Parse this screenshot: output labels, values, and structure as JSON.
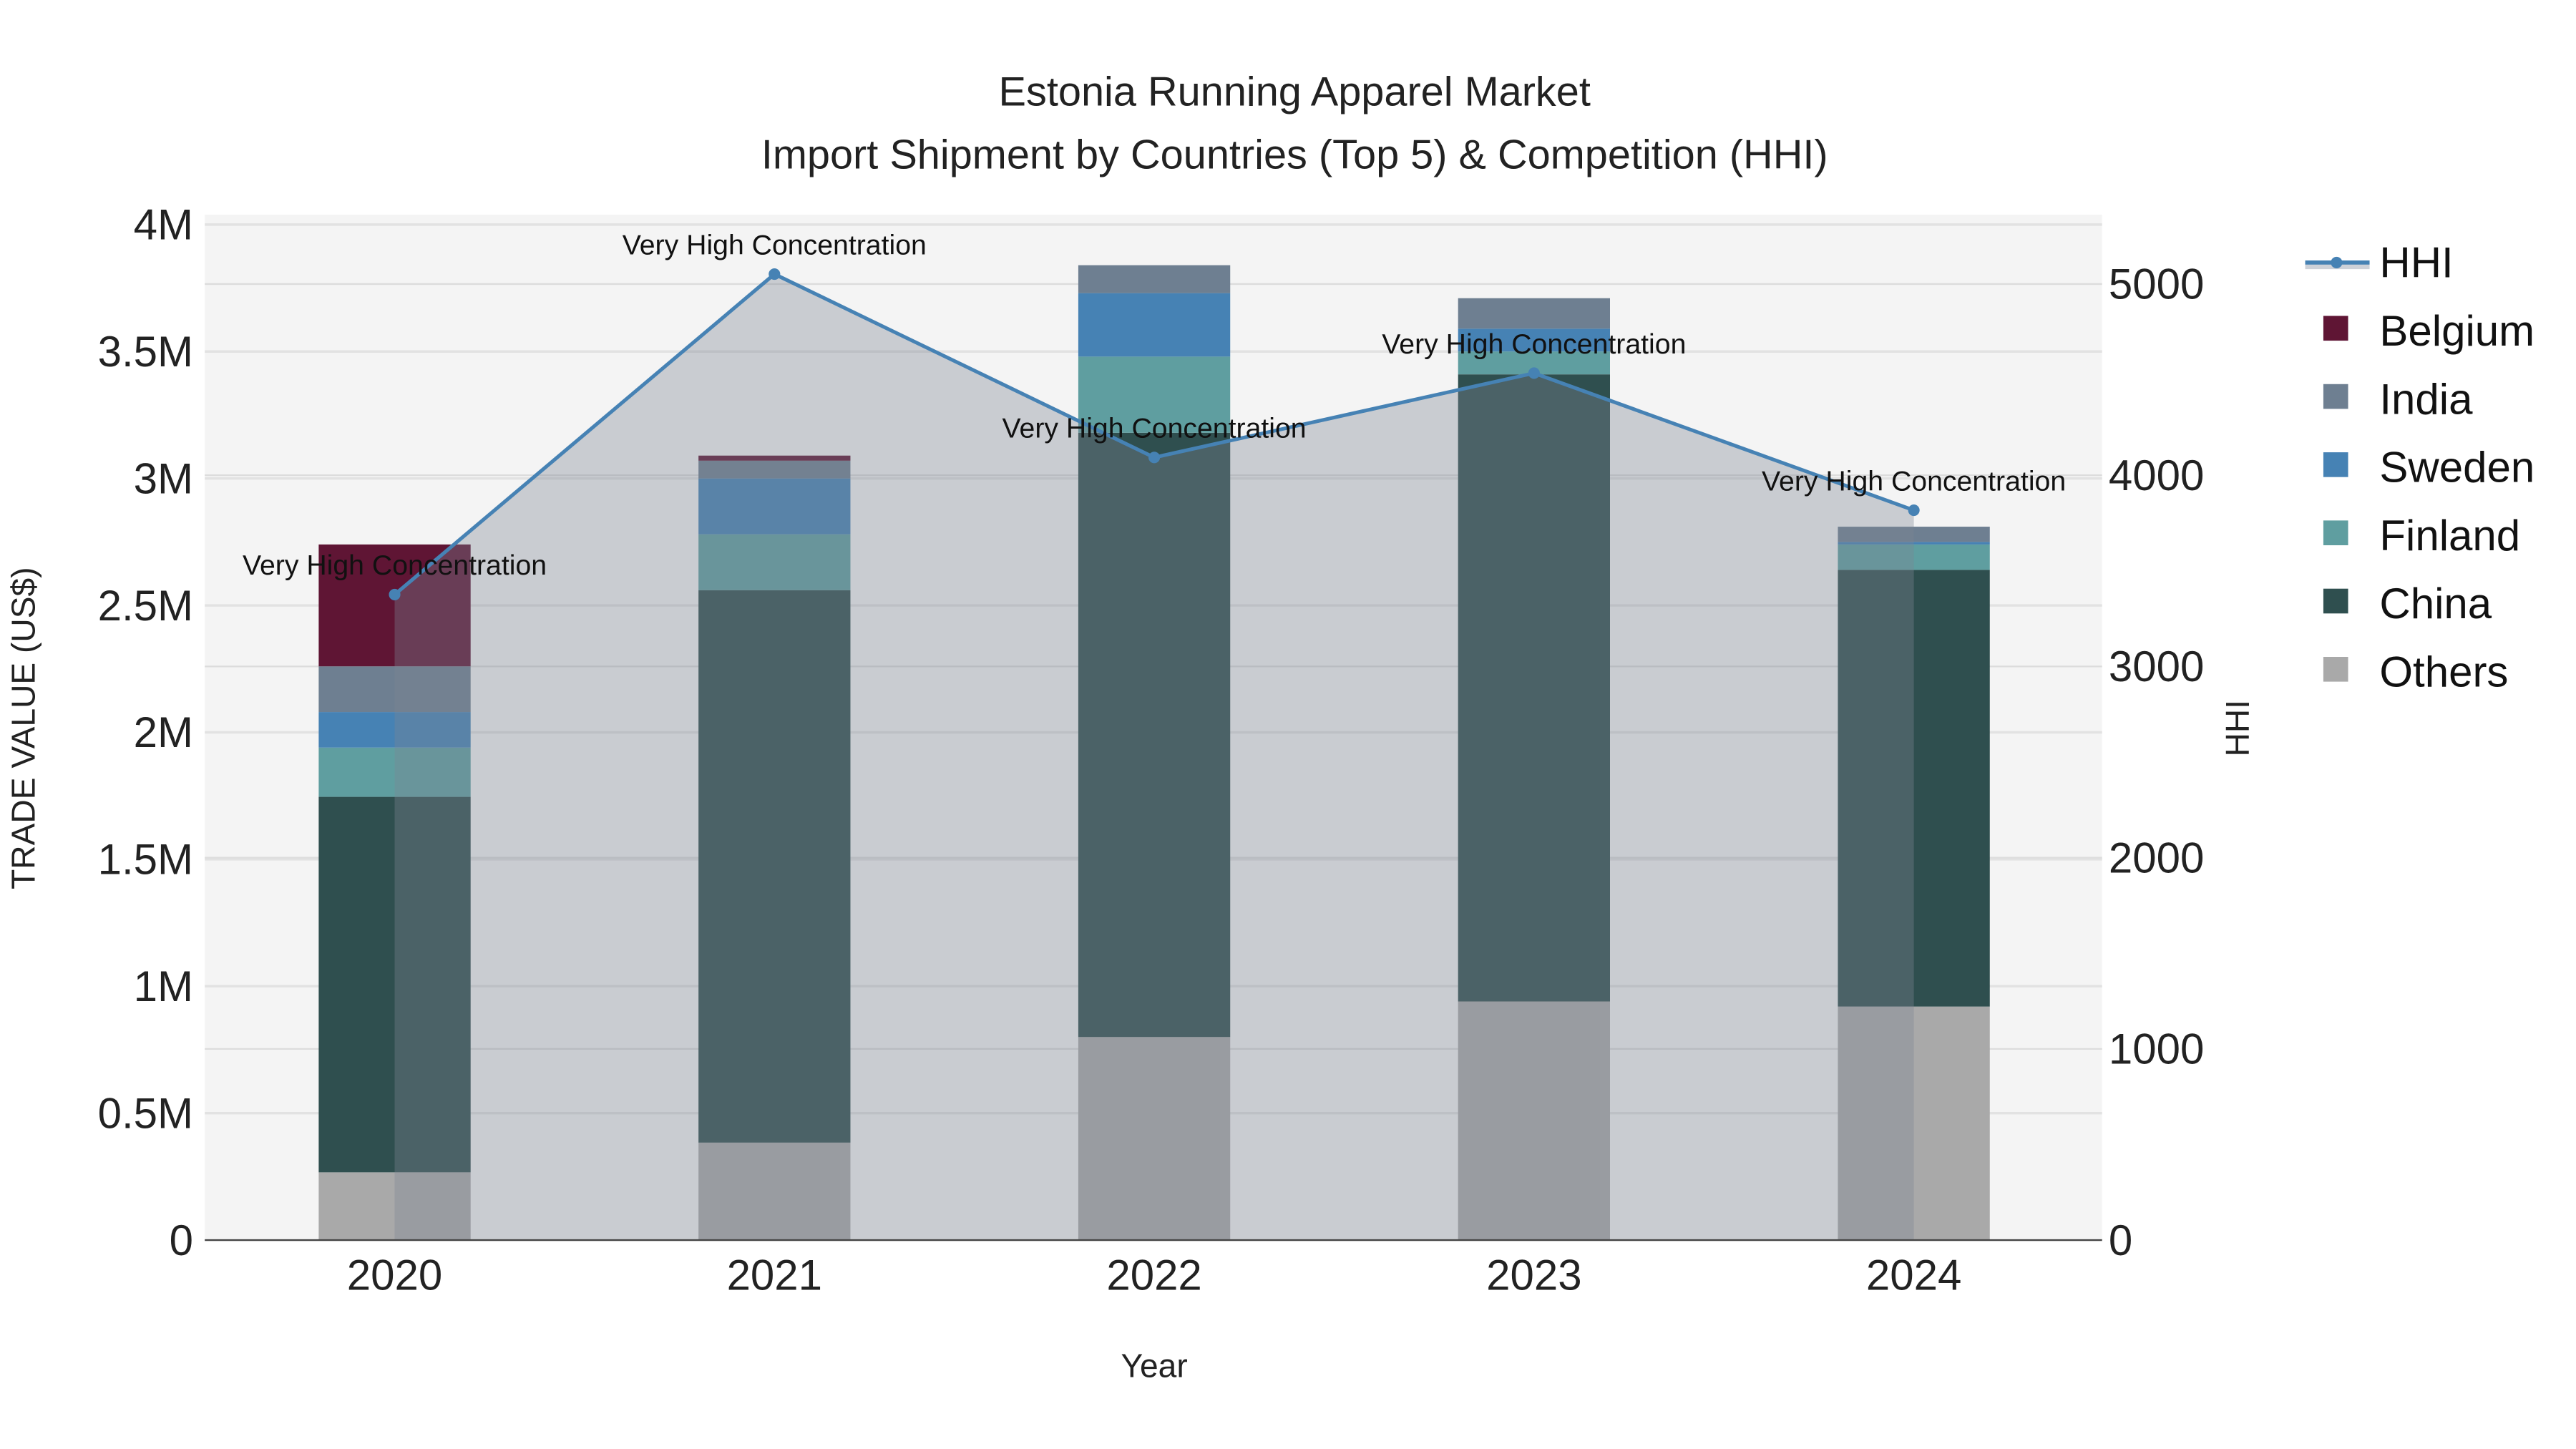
{
  "chart_data": {
    "type": "bar",
    "title": "Estonia Running Apparel Market",
    "subtitle": "Import Shipment by Countries (Top 5) & Competition (HHI)",
    "xlabel": "Year",
    "ylabel": "TRADE VALUE (US$)",
    "y2label": "HHI",
    "categories": [
      "2020",
      "2021",
      "2022",
      "2023",
      "2024"
    ],
    "ylim": [
      0,
      4000000
    ],
    "y2lim": [
      0,
      5350
    ],
    "yticks": [
      0,
      500000,
      1000000,
      1500000,
      2000000,
      2500000,
      3000000,
      3500000,
      4000000
    ],
    "ytick_labels": [
      "0",
      "0.5M",
      "1M",
      "1.5M",
      "2M",
      "2.5M",
      "3M",
      "3.5M",
      "4M"
    ],
    "y2ticks": [
      0,
      1000,
      2000,
      3000,
      4000,
      5000
    ],
    "y2tick_labels": [
      "0",
      "1000",
      "2000",
      "3000",
      "4000",
      "5000"
    ],
    "series": [
      {
        "name": "Others",
        "color": "#a9a9a9",
        "values": [
          267000,
          384000,
          800000,
          940000,
          920000
        ]
      },
      {
        "name": "China",
        "color": "#2f4f4f",
        "values": [
          1479000,
          2176000,
          2380000,
          2470000,
          1720000
        ]
      },
      {
        "name": "Finland",
        "color": "#5f9ea0",
        "values": [
          194000,
          220000,
          300000,
          90000,
          100000
        ]
      },
      {
        "name": "Sweden",
        "color": "#4682b4",
        "values": [
          140000,
          220000,
          250000,
          90000,
          10000
        ]
      },
      {
        "name": "India",
        "color": "#6e7f91",
        "values": [
          180000,
          70000,
          110000,
          120000,
          60000
        ]
      },
      {
        "name": "Belgium",
        "color": "#5f1534",
        "values": [
          480000,
          20000,
          0,
          0,
          0
        ]
      }
    ],
    "hhi": {
      "name": "HHI",
      "color": "#4682b4",
      "values": [
        3376,
        5052,
        4093,
        4534,
        3817
      ],
      "annotations": [
        "Very High Concentration",
        "Very High Concentration",
        "Very High Concentration",
        "Very High Concentration",
        "Very High Concentration"
      ]
    },
    "legend": [
      "HHI",
      "Belgium",
      "India",
      "Sweden",
      "Finland",
      "China",
      "Others"
    ],
    "legend_position": "right",
    "grid": true
  }
}
